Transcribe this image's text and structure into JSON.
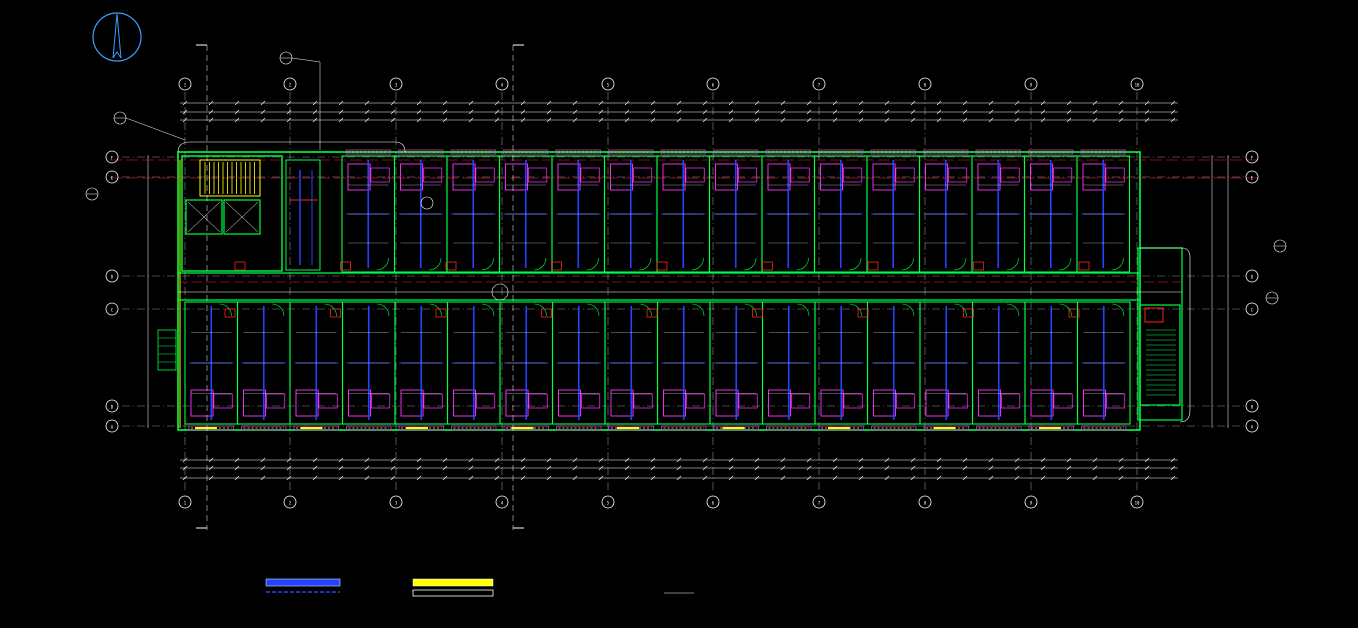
{
  "axes": {
    "vertical": [
      "1",
      "2",
      "3",
      "4",
      "5",
      "6",
      "7",
      "8",
      "9",
      "10"
    ],
    "horizontal": [
      "F",
      "E",
      "D",
      "C",
      "B",
      "A"
    ]
  },
  "legend": {
    "item1": "",
    "item2": "",
    "item3": "",
    "item4": ""
  },
  "title": {
    "main": "",
    "scale": "",
    "sub": ""
  },
  "colors": {
    "background": "#000000",
    "wall": "#00ff44",
    "pipe": "#2244ff",
    "equipment": "#ff33ff",
    "highlight": "#ffff00",
    "accent_red": "#ff2222",
    "dimension": "#ffffff"
  },
  "icons": {
    "north_arrow": "north-arrow-icon",
    "stair": "stair-icon",
    "elevator": "elevator-icon"
  }
}
